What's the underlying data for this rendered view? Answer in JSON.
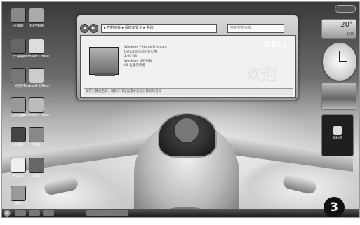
{
  "desktop_icons": [
    {
      "label": "回收站"
    },
    {
      "label": "我的电脑"
    },
    {
      "label": "计算机"
    },
    {
      "label": "Microsoft Office Exc..."
    },
    {
      "label": "网络"
    },
    {
      "label": "Microsoft Office Wor..."
    },
    {
      "label": "控制面板"
    },
    {
      "label": "Microsoft Office Pow..."
    },
    {
      "label": "回收站"
    },
    {
      "label": "搜狗"
    },
    {
      "label": "Adobe"
    },
    {
      "label": "帮助"
    },
    {
      "label": "用户"
    }
  ],
  "window": {
    "nav_back": "◄",
    "nav_forward": "►",
    "address": "▸ 控制面板 ▸ 系统和安全 ▸ 系统",
    "search_placeholder": "搜索控制面板",
    "brand": "DELL",
    "watermark": "欢迎",
    "info_lines": [
      "Windows 7 Home Premium",
      "Genuine Intel(R) CPU",
      "2.00 GB",
      "Windows 体验指数",
      "64 位操作系统"
    ],
    "status": "请在计算机名称、域和工作组设置中更改计算机的名称"
  },
  "gadgets": {
    "weather_temp": "20°",
    "weather_city": "北京",
    "rss_label": "源标题"
  },
  "badge_number": "3"
}
